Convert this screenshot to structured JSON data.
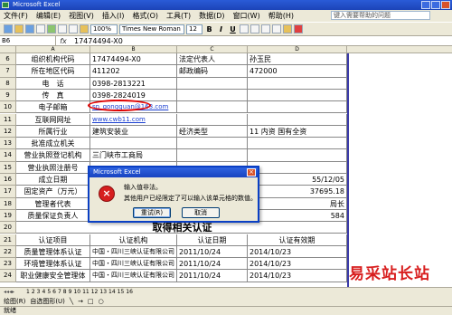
{
  "window": {
    "title": "Microsoft Excel"
  },
  "menu": [
    "文件(F)",
    "编辑(E)",
    "视图(V)",
    "插入(I)",
    "格式(O)",
    "工具(T)",
    "数据(D)",
    "窗口(W)",
    "帮助(H)"
  ],
  "help_placeholder": "键入需要帮助的问题",
  "toolbar": {
    "zoom": "100%",
    "font": "Times New Roman",
    "size": "12"
  },
  "formula": {
    "namebox": "B6",
    "fx": "fx",
    "value": "17474494-X0"
  },
  "columns": [
    "A",
    "B",
    "C",
    "D"
  ],
  "rows": [
    {
      "n": "6",
      "a": "组织机构代码",
      "b": "17474494-X0",
      "c": "法定代表人",
      "d": "孙玉民"
    },
    {
      "n": "7",
      "a": "所在地区代码",
      "b": "411202",
      "c": "邮政编码",
      "d": "472000"
    },
    {
      "n": "8",
      "a": "电　话",
      "b": "0398-2813221"
    },
    {
      "n": "9",
      "a": "传　真",
      "b": "0398-2824019"
    },
    {
      "n": "10",
      "a": "电子邮箱",
      "b": "sn_gongguan@163.com"
    },
    {
      "n": "11",
      "a": "互联网网址",
      "b": "www.cwb11.com"
    },
    {
      "n": "12",
      "a": "所属行业",
      "b": "建筑安装业",
      "c": "经济类型",
      "d": "11 内资 国有全资"
    },
    {
      "n": "13",
      "a": "批准成立机关"
    },
    {
      "n": "14",
      "a": "营业执照登记机构",
      "b": "三门峡市工商局"
    },
    {
      "n": "15",
      "a": "营业执照注册号"
    },
    {
      "n": "16",
      "a": "成立日期",
      "d": "55/12/05"
    },
    {
      "n": "17",
      "a": "固定资产（万元）",
      "d": "37695.18"
    },
    {
      "n": "18",
      "a": "管理者代表",
      "d": "局长"
    },
    {
      "n": "19",
      "a": "质量保证负责人",
      "d": "584"
    },
    {
      "n": "20",
      "title": "取得相关认证"
    },
    {
      "n": "21",
      "a": "认证项目",
      "b": "认证机构",
      "c": "认证日期",
      "d": "认证有效期"
    },
    {
      "n": "22",
      "a": "质量管理体系认证",
      "b": "中国・四川三峡认证有限公司",
      "c": "2011/10/24",
      "d": "2014/10/23"
    },
    {
      "n": "23",
      "a": "环境管理体系认证",
      "b": "中国・四川三峡认证有限公司",
      "c": "2011/10/24",
      "d": "2014/10/23"
    },
    {
      "n": "24",
      "a": "职业健康安全管理体",
      "b": "中国・四川三峡认证有限公司",
      "c": "2011/10/24",
      "d": "2014/10/23"
    }
  ],
  "dialog": {
    "title": "Microsoft Excel",
    "line1": "输入值非法。",
    "line2": "其他用户已经限定了可以输入该单元格的数值。",
    "retry": "重试(R)",
    "cancel": "取消"
  },
  "sheet_tabs": [
    "1",
    "2",
    "3",
    "4",
    "5",
    "6",
    "7",
    "8",
    "9",
    "10",
    "11",
    "12",
    "13",
    "14",
    "15",
    "16"
  ],
  "drawbar": {
    "draw": "绘图(R)",
    "autoshapes": "自选图形(U)"
  },
  "status": "就绪",
  "watermark": "易采站长站"
}
